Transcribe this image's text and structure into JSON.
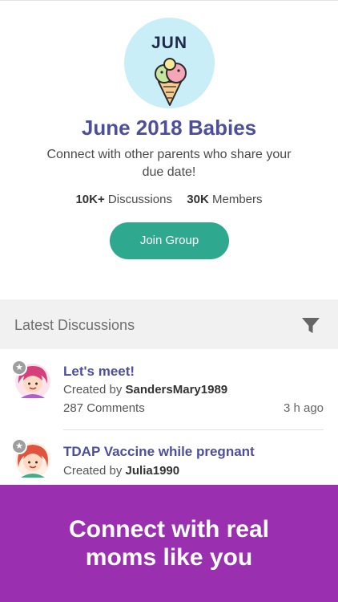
{
  "group": {
    "month_badge": "JUN",
    "title": "June 2018 Babies",
    "description": "Connect with other parents who share your due date!",
    "discussions_count": "10K+",
    "discussions_label": "Discussions",
    "members_count": "30K",
    "members_label": "Members",
    "join_label": "Join Group",
    "avatar_bg": "#c9eef8",
    "accent_color": "#2ea88f",
    "title_color": "#4e4f9a"
  },
  "discussions": {
    "header": "Latest Discussions",
    "filter_icon": "filter-icon",
    "items": [
      {
        "title": "Let's meet!",
        "created_prefix": "Created by",
        "author": "SandersMary1989",
        "comments": "287 Comments",
        "time": "3 h ago",
        "badge_icon": "star-icon"
      },
      {
        "title": "TDAP Vaccine while pregnant",
        "created_prefix": "Created by",
        "author": "Julia1990",
        "badge_icon": "star-icon"
      }
    ]
  },
  "promo": {
    "text": "Connect with real\nmoms like you",
    "bg_color": "#9a2fb0"
  }
}
